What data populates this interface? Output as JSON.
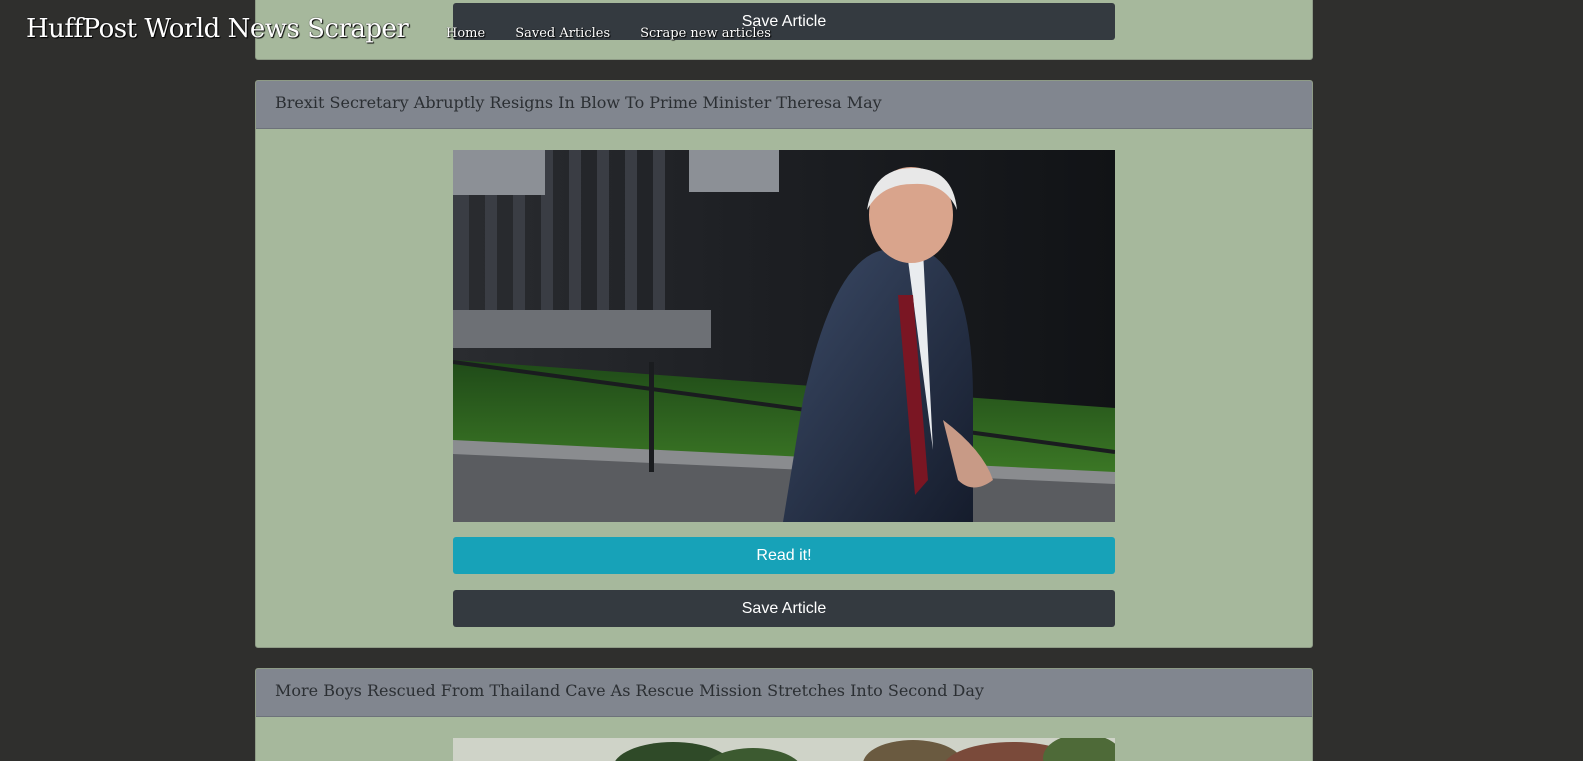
{
  "header": {
    "title": "HuffPost World News Scraper",
    "nav": {
      "home": "Home",
      "saved": "Saved Articles",
      "scrape": "Scrape new articles"
    }
  },
  "articles": [
    {
      "title": "",
      "save_label": "Save Article"
    },
    {
      "title": "Brexit Secretary Abruptly Resigns In Blow To Prime Minister Theresa May",
      "read_label": "Read it!",
      "save_label": "Save Article"
    },
    {
      "title": "More Boys Rescued From Thailand Cave As Rescue Mission Stretches Into Second Day"
    }
  ],
  "colors": {
    "page_bg": "#2f2f2d",
    "card_bg": "#a6b89c",
    "card_header_bg": "#81868f",
    "read_button": "#17a2b8",
    "save_button": "#343a40"
  }
}
